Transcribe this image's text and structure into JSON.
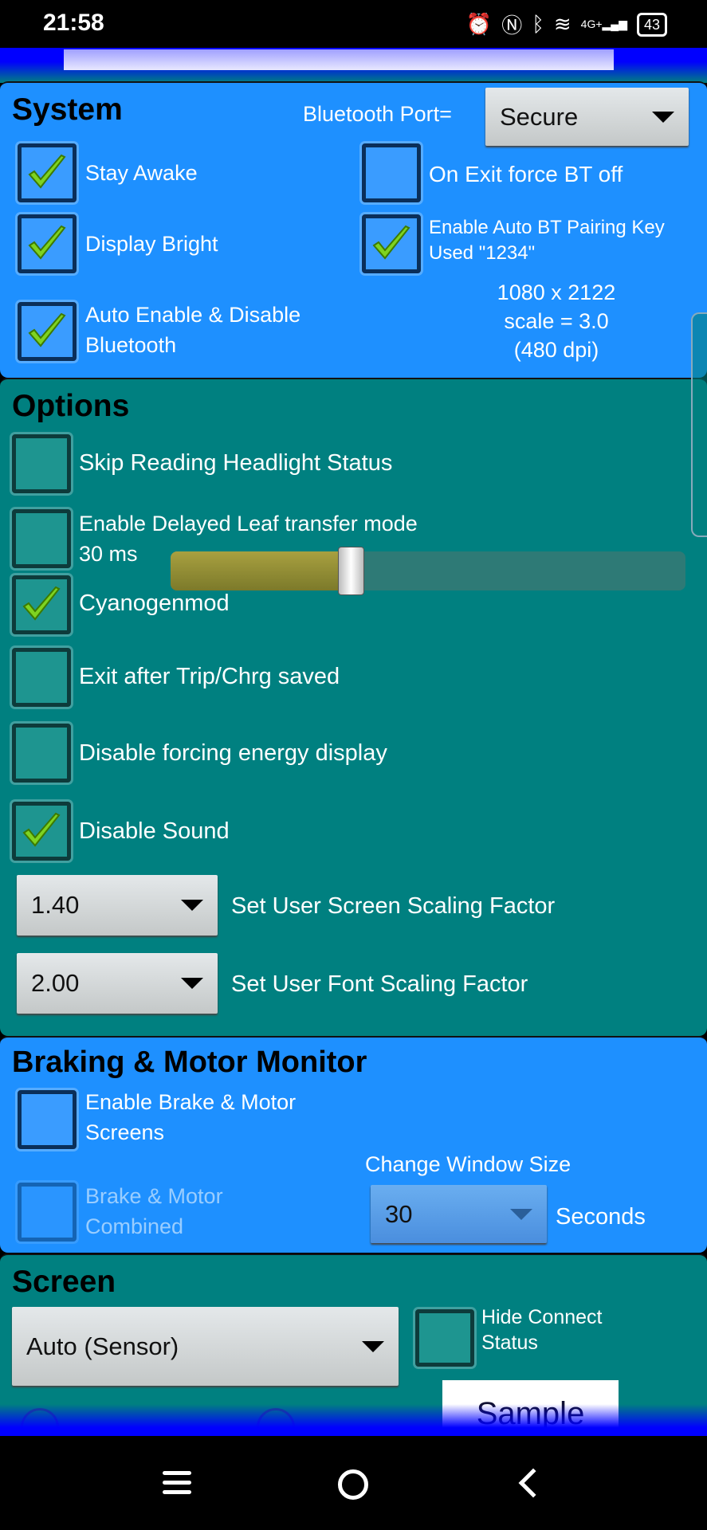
{
  "status_bar": {
    "time": "21:58",
    "network": "4G+",
    "battery": "43",
    "icons": [
      "alarm-icon",
      "nfc-icon",
      "bluetooth-icon",
      "wifi-icon",
      "signal-icon",
      "battery-icon"
    ]
  },
  "colors": {
    "system_panel": "#1e90ff",
    "options_panel": "#008080",
    "check": "#7ed321"
  },
  "system": {
    "title": "System",
    "bt_port_label": "Bluetooth Port=",
    "bt_port_value": "Secure",
    "stay_awake": {
      "label": "Stay Awake",
      "checked": true
    },
    "display_bright": {
      "label": "Display Bright",
      "checked": true
    },
    "auto_bt": {
      "label": "Auto Enable & Disable Bluetooth",
      "checked": true
    },
    "exit_bt_off": {
      "label": "On Exit force BT off",
      "checked": false
    },
    "auto_pairing": {
      "label": "Enable Auto BT Pairing Key Used \"1234\"",
      "checked": true
    },
    "resolution": "1080 x 2122",
    "scale": "scale = 3.0",
    "dpi": "(480 dpi)"
  },
  "options": {
    "title": "Options",
    "skip_headlight": {
      "label": "Skip Reading Headlight Status",
      "checked": false
    },
    "delayed_leaf": {
      "label": "Enable Delayed Leaf transfer mode",
      "checked": false
    },
    "delay_value": "30 ms",
    "delay_slider_fraction": 0.35,
    "cyanogenmod": {
      "label": "Cyanogenmod",
      "checked": true
    },
    "exit_after": {
      "label": "Exit after Trip/Chrg saved",
      "checked": false
    },
    "disable_energy": {
      "label": "Disable forcing energy display",
      "checked": false
    },
    "disable_sound": {
      "label": "Disable Sound",
      "checked": true
    },
    "screen_scaling_value": "1.40",
    "screen_scaling_label": "Set User Screen Scaling Factor",
    "font_scaling_value": "2.00",
    "font_scaling_label": "Set User Font Scaling Factor"
  },
  "braking": {
    "title": "Braking & Motor Monitor",
    "enable": {
      "label": "Enable Brake & Motor Screens",
      "checked": false
    },
    "combined": {
      "label": "Brake & Motor Combined",
      "checked": false,
      "disabled": true
    },
    "window_label": "Change Window Size",
    "window_value": "30",
    "seconds": "Seconds"
  },
  "screen": {
    "title": "Screen",
    "orientation": "Auto (Sensor)",
    "hide_connect": {
      "label": "Hide Connect Status",
      "checked": false
    },
    "sample": "Sample"
  },
  "nav": {
    "icons": [
      "menu-icon",
      "home-icon",
      "back-icon"
    ]
  }
}
